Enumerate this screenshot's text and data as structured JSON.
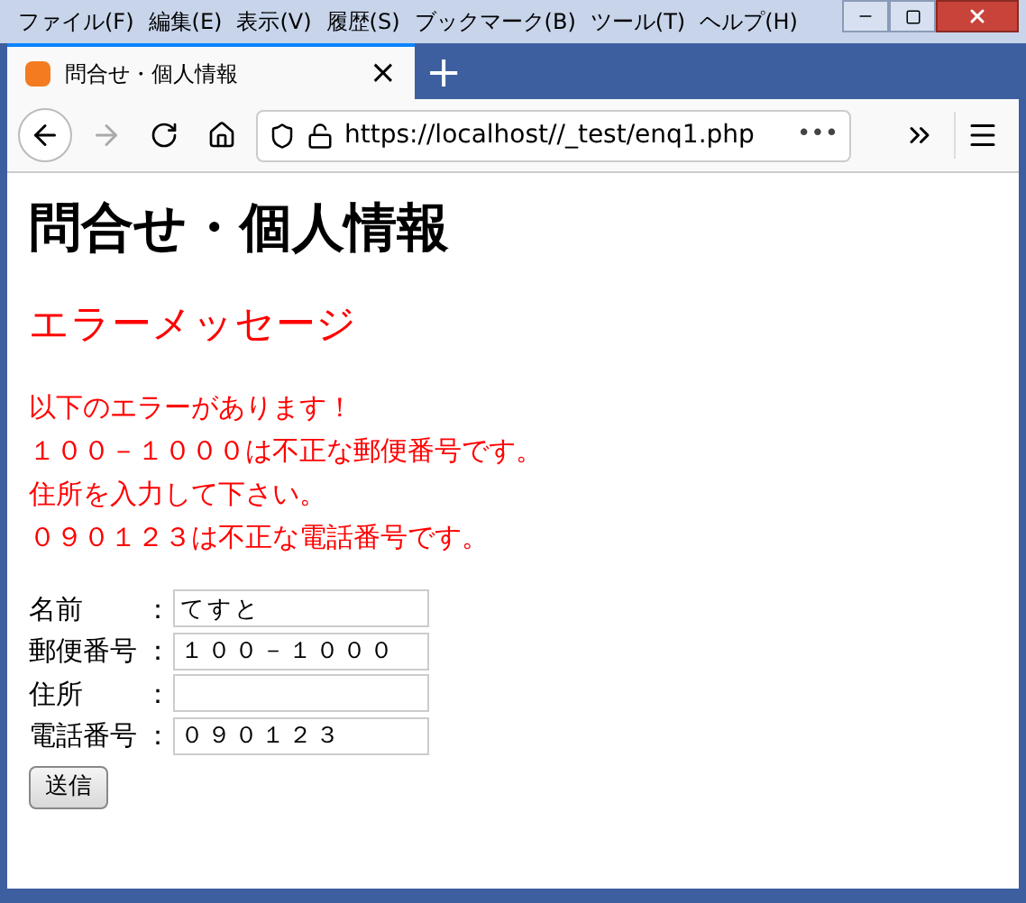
{
  "menu": [
    "ファイル(F)",
    "編集(E)",
    "表示(V)",
    "履歴(S)",
    "ブックマーク(B)",
    "ツール(T)",
    "ヘルプ(H)"
  ],
  "tabs": [
    {
      "title": "問合せ・個人情報",
      "selected": true,
      "close": "×"
    }
  ],
  "new_tab": "+",
  "address_bar": {
    "url": "https://localhost//_test/enq1.php",
    "more": "•••"
  },
  "page": {
    "title": "問合せ・個人情報",
    "error_heading": "エラーメッセージ",
    "errors": [
      "以下のエラーがあります！",
      "１００－１０００は不正な郵便番号です。",
      "住所を入力して下さい。",
      "０９０１２３は不正な電話番号です。"
    ],
    "fields": [
      {
        "label": "名前",
        "separator": "：",
        "value": "てすと"
      },
      {
        "label": "郵便番号",
        "separator": "：",
        "value": "１００－１０００"
      },
      {
        "label": "住所",
        "separator": "："
      },
      {
        "label": "電話番号",
        "separator": "：",
        "value": "０９０１２３"
      }
    ],
    "submit": "送信"
  }
}
